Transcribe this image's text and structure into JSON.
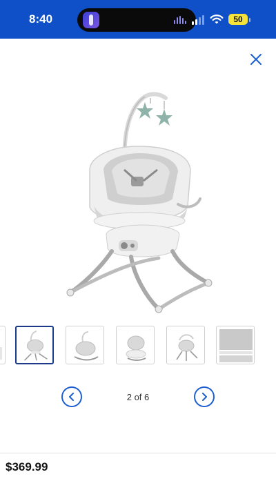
{
  "status_bar": {
    "time": "8:40",
    "battery_level": "50",
    "background_color": "#0f4fc7",
    "icons": [
      "cellular-signal-icon",
      "wifi-icon",
      "battery-icon",
      "dynamic-island-app-icon",
      "audio-wave-icon"
    ]
  },
  "gallery": {
    "close_icon": "close-icon",
    "main_image_subject": "baby swing with mobile",
    "thumbnail_count": 6,
    "selected_index": 2,
    "page_indicator": "2 of 6",
    "prev_icon": "chevron-left-icon",
    "next_icon": "chevron-right-icon",
    "accent_color": "#1b5fd0"
  },
  "product": {
    "price": "$369.99"
  }
}
